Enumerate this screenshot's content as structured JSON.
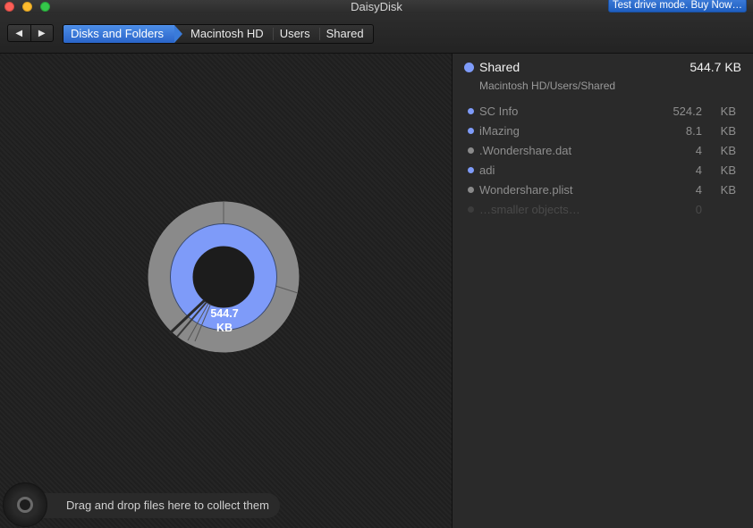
{
  "window": {
    "title": "DaisyDisk",
    "buy_badge": "Test drive mode. Buy Now…"
  },
  "toolbar": {
    "back_icon": "◀",
    "forward_icon": "▶",
    "breadcrumb": [
      "Disks and Folders",
      "Macintosh HD",
      "Users",
      "Shared"
    ]
  },
  "chart_center": {
    "size_value": "544.7",
    "size_unit": "KB"
  },
  "drop_zone": {
    "label": "Drag and drop files here to collect them"
  },
  "details": {
    "name": "Shared",
    "size": "544.7 KB",
    "path": "Macintosh HD/Users/Shared",
    "items": [
      {
        "name": "SC Info",
        "value": "524.2",
        "unit": "KB",
        "color": "#7e9bf9"
      },
      {
        "name": "iMazing",
        "value": "8.1",
        "unit": "KB",
        "color": "#7e9bf9"
      },
      {
        "name": ".Wondershare.dat",
        "value": "4",
        "unit": "KB",
        "color": "#8a8a8a"
      },
      {
        "name": "adi",
        "value": "4",
        "unit": "KB",
        "color": "#7e9bf9"
      },
      {
        "name": "Wondershare.plist",
        "value": "4",
        "unit": "KB",
        "color": "#8a8a8a"
      },
      {
        "name": "…smaller objects…",
        "value": "0",
        "unit": "",
        "color": "#3c3c3c"
      }
    ]
  },
  "colors": {
    "folder": "#7e9bf9",
    "file": "#8a8a8a",
    "accent": "#2a65c9"
  }
}
